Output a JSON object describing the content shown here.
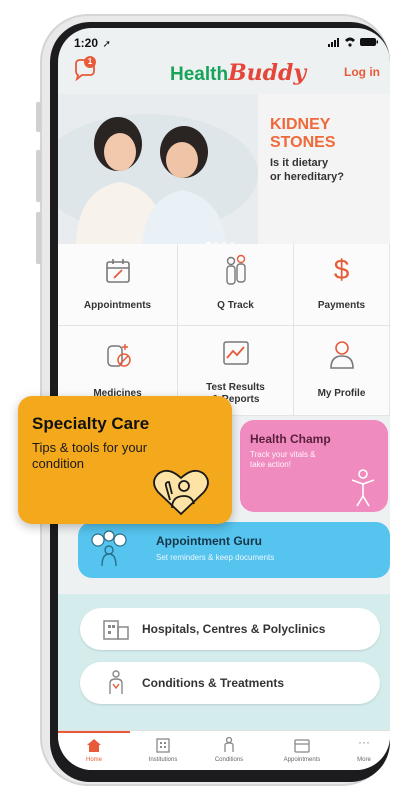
{
  "status_bar": {
    "time": "1:20"
  },
  "header": {
    "brand_part1": "Health",
    "brand_part2": "Buddy",
    "login_label": "Log in",
    "notification_count": "1"
  },
  "banner": {
    "title_line1": "KIDNEY",
    "title_line2": "STONES",
    "subtitle_line1": "Is it dietary",
    "subtitle_line2": "or hereditary?"
  },
  "grid": {
    "appointments": "Appointments",
    "qtrack": "Q Track",
    "payments": "Payments",
    "medicines": "Medicines",
    "test_results_line1": "Test Results",
    "test_results_line2": "& Reports",
    "my_profile": "My Profile"
  },
  "specialty_care": {
    "title": "Specialty Care",
    "description_line1": "Tips & tools for your",
    "description_line2": "condition"
  },
  "health_champ": {
    "title": "Health Champ",
    "desc_line1": "Track your vitals &",
    "desc_line2": "take action!"
  },
  "appointment_guru": {
    "title": "Appointment Guru",
    "desc": "Set reminders & keep documents"
  },
  "links": {
    "hospitals": "Hospitals, Centres & Polyclinics",
    "conditions": "Conditions & Treatments"
  },
  "bottom_nav": [
    "Home",
    "Institutions",
    "Conditions",
    "Appointments",
    "More"
  ],
  "colors": {
    "brand_green": "#17a35a",
    "accent_orange": "#f4a81c",
    "health_champ_pink": "#f08bc0",
    "appointment_guru_blue": "#55c4ee",
    "teal_section": "#d4ecec"
  }
}
